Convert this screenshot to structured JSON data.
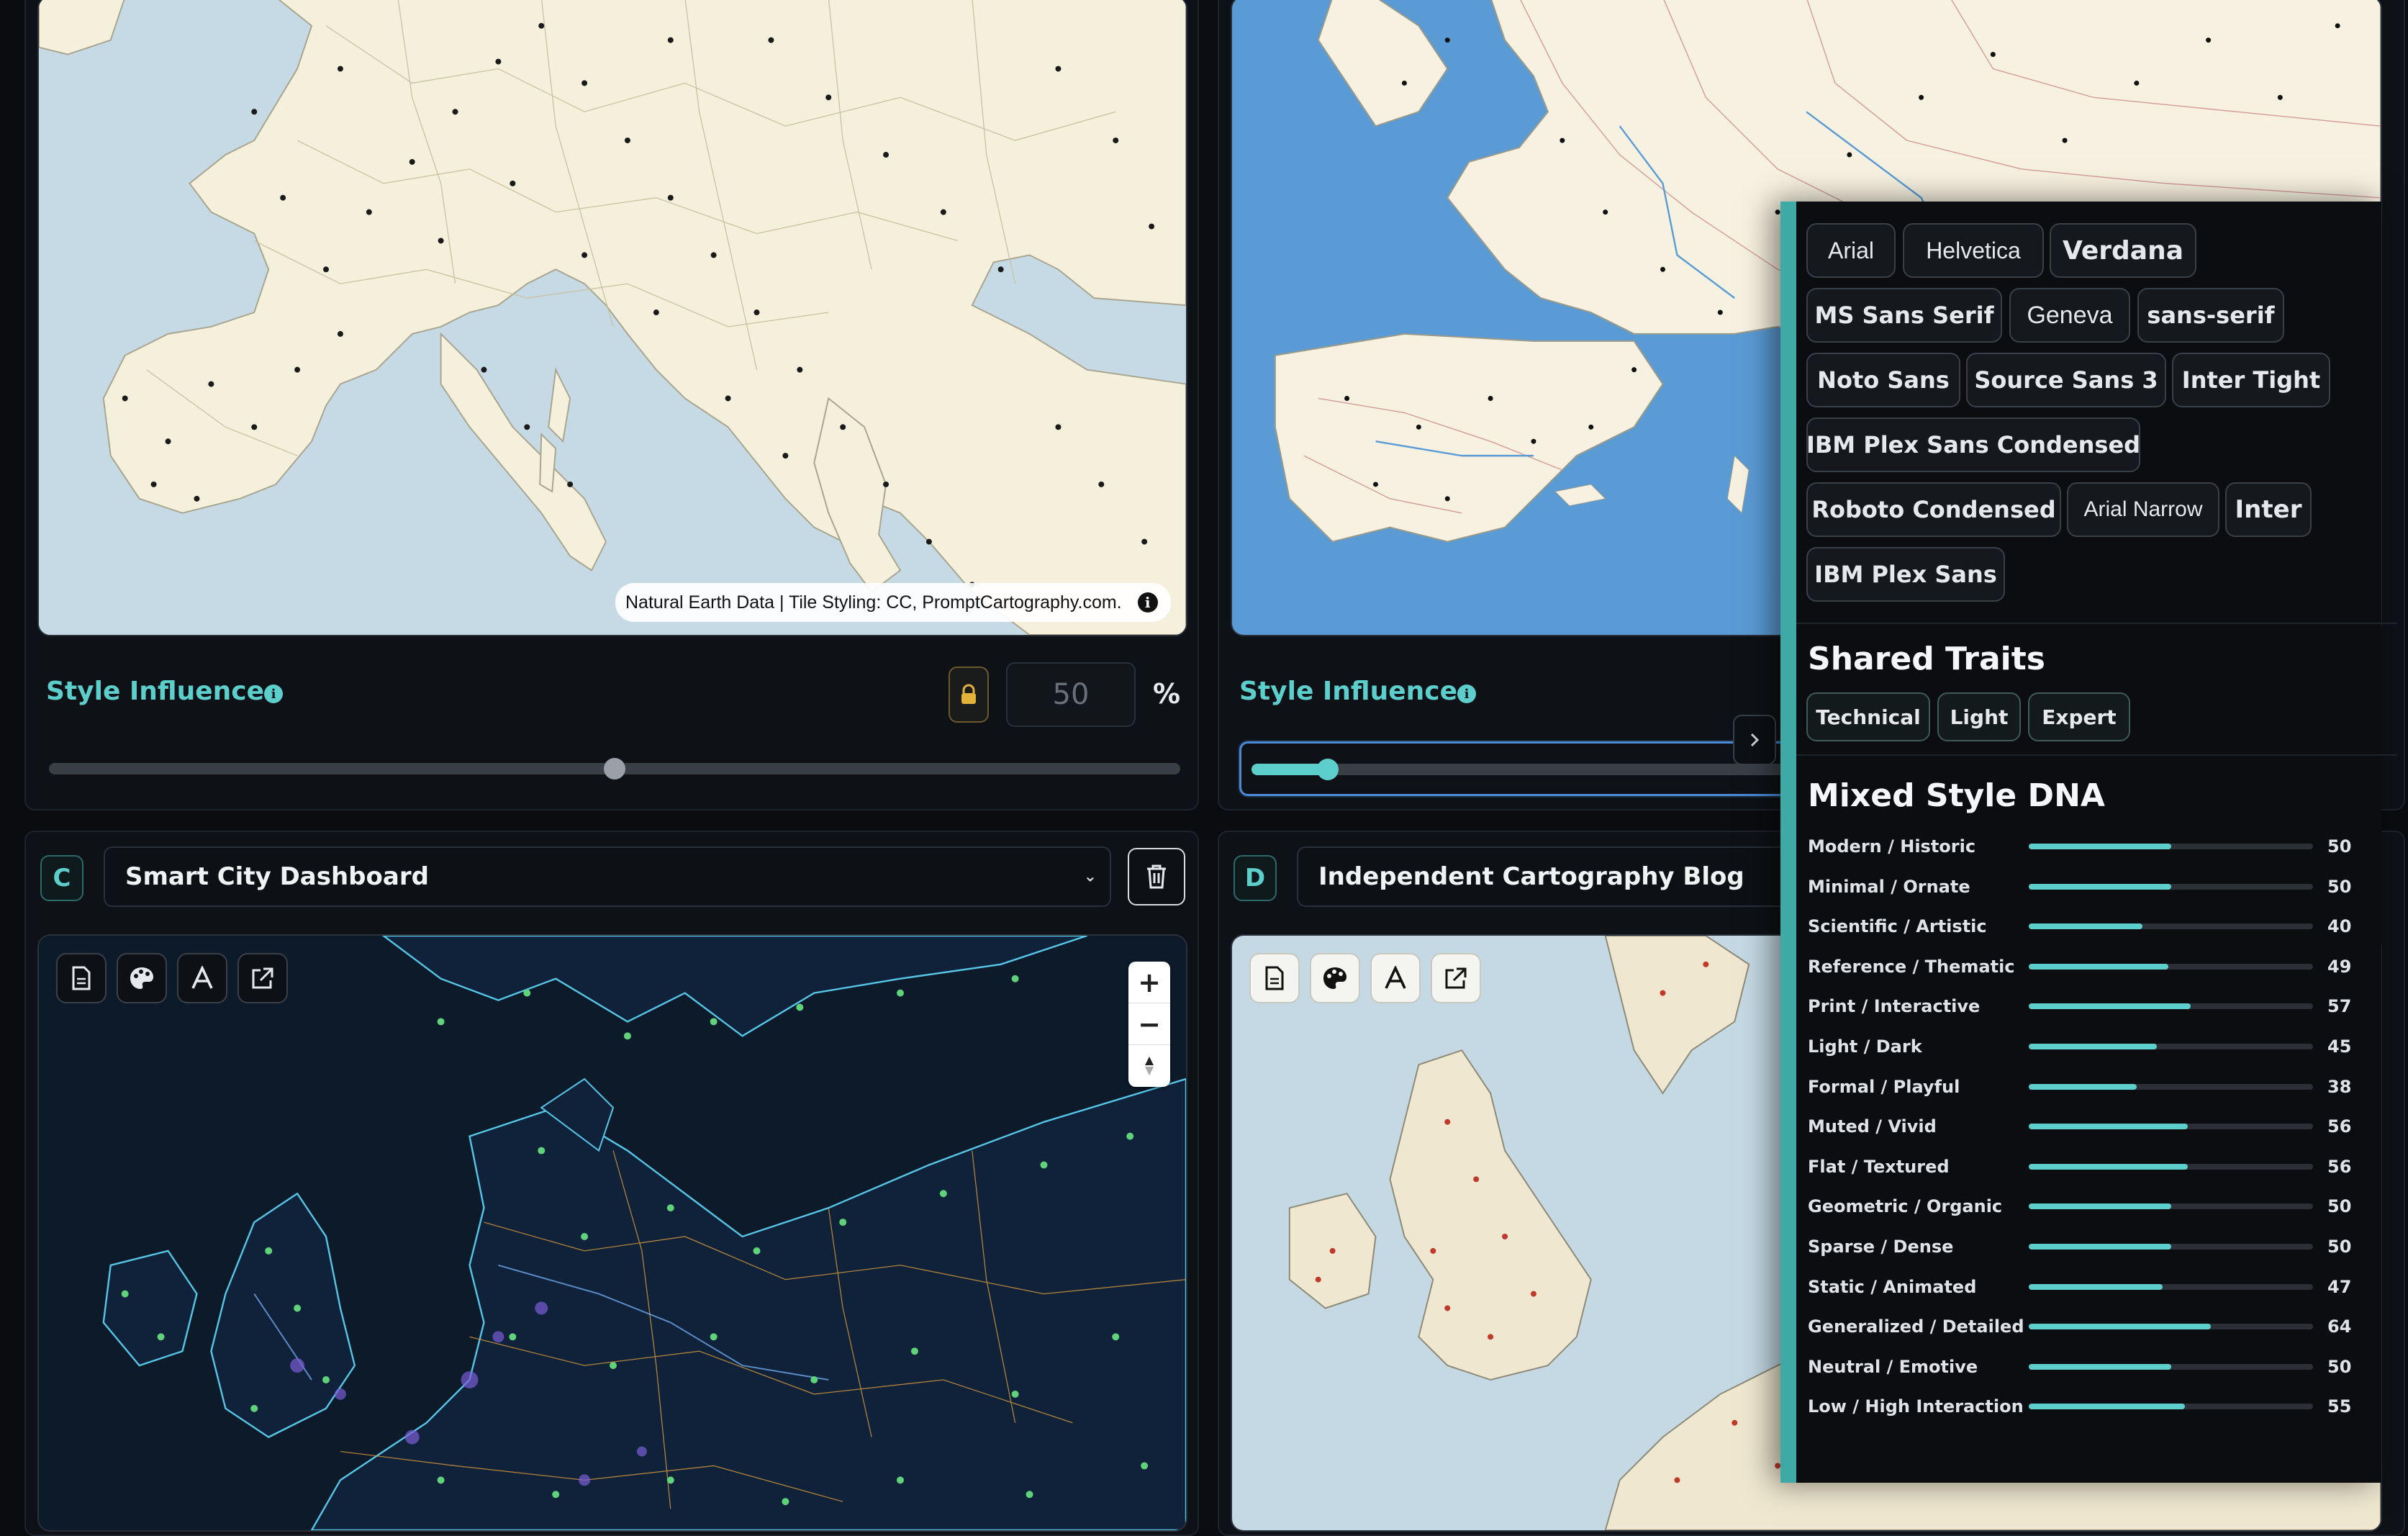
{
  "panels": {
    "a": {
      "attribution": "Natural Earth Data | Tile Styling: CC, PromptCartography.com.",
      "style_influence_label": "Style Influence",
      "value": "50",
      "unit": "%",
      "slider_level": 0.5
    },
    "b": {
      "style_influence_label": "Style Influence",
      "slider_level": 0.12
    },
    "c": {
      "letter": "C",
      "dataset": "Smart City Dashboard"
    },
    "d": {
      "letter": "D",
      "dataset": "Independent Cartography Blog"
    }
  },
  "icons": {
    "lock": "lock-icon",
    "info": "info-icon",
    "trash": "trash-icon",
    "document": "document-icon",
    "palette": "palette-icon",
    "font": "font-icon",
    "external": "external-link-icon",
    "zoom_in": "zoom-in-icon",
    "zoom_out": "zoom-out-icon",
    "compass": "compass-icon"
  },
  "colors": {
    "accent": "#5ccfcc",
    "overlay_bg": "#0b0d10",
    "slider_active": "#5ccfcc"
  },
  "overlay": {
    "fonts": [
      "Arial",
      "Helvetica",
      "Verdana",
      "MS Sans Serif",
      "Geneva",
      "sans-serif",
      "Noto Sans",
      "Source Sans 3",
      "Inter Tight",
      "IBM Plex Sans Condensed",
      "Roboto Condensed",
      "Arial Narrow",
      "Inter",
      "IBM Plex Sans"
    ],
    "shared_traits_title": "Shared Traits",
    "traits": [
      "Technical",
      "Light",
      "Expert"
    ],
    "dna_title": "Mixed Style DNA",
    "dna": [
      {
        "label": "Modern / Historic",
        "value": 50
      },
      {
        "label": "Minimal / Ornate",
        "value": 50
      },
      {
        "label": "Scientific / Artistic",
        "value": 40
      },
      {
        "label": "Reference / Thematic",
        "value": 49
      },
      {
        "label": "Print / Interactive",
        "value": 57
      },
      {
        "label": "Light / Dark",
        "value": 45
      },
      {
        "label": "Formal / Playful",
        "value": 38
      },
      {
        "label": "Muted / Vivid",
        "value": 56
      },
      {
        "label": "Flat / Textured",
        "value": 56
      },
      {
        "label": "Geometric / Organic",
        "value": 50
      },
      {
        "label": "Sparse / Dense",
        "value": 50
      },
      {
        "label": "Static / Animated",
        "value": 47
      },
      {
        "label": "Generalized / Detailed",
        "value": 64
      },
      {
        "label": "Neutral / Emotive",
        "value": 50
      },
      {
        "label": "Low / High Interaction",
        "value": 55
      }
    ]
  }
}
